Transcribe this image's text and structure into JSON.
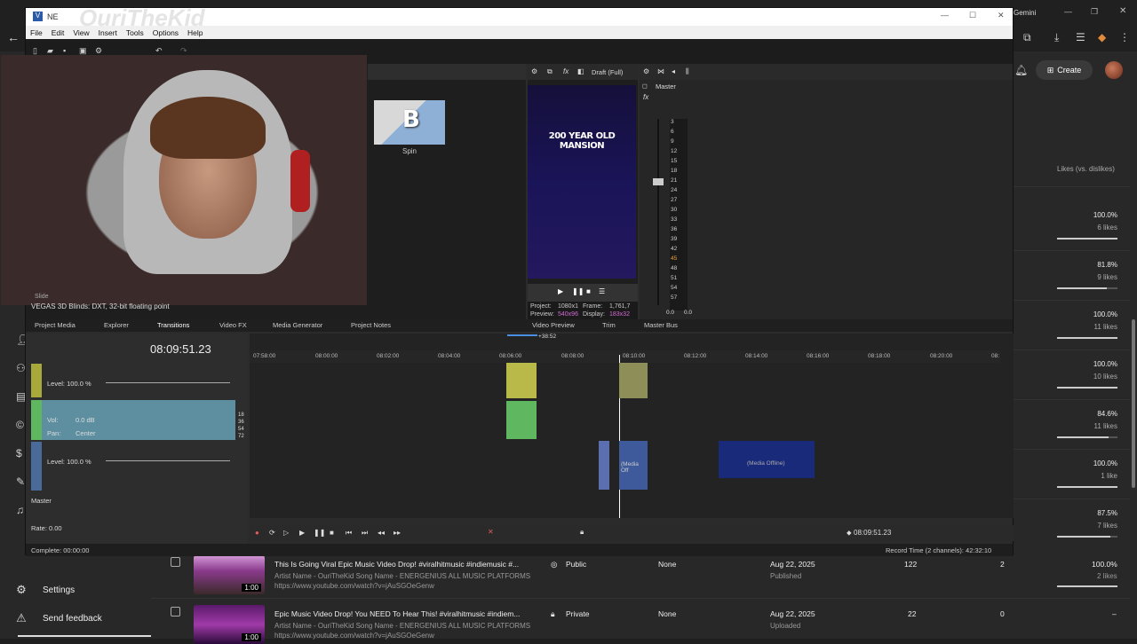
{
  "studio": {
    "create_label": "Create",
    "gemini_label": "Gemini",
    "likes_header": "Likes (vs. dislikes)",
    "likes": [
      {
        "pct": "100.0%",
        "count": "6 likes",
        "fill": 1.0
      },
      {
        "pct": "81.8%",
        "count": "9 likes",
        "fill": 0.818
      },
      {
        "pct": "100.0%",
        "count": "11 likes",
        "fill": 1.0
      },
      {
        "pct": "100.0%",
        "count": "10 likes",
        "fill": 1.0
      },
      {
        "pct": "84.6%",
        "count": "11 likes",
        "fill": 0.846
      },
      {
        "pct": "100.0%",
        "count": "1 like",
        "fill": 1.0
      },
      {
        "pct": "87.5%",
        "count": "7 likes",
        "fill": 0.875
      }
    ],
    "sidebar": {
      "settings": "Settings",
      "send_feedback": "Send feedback"
    },
    "videos": [
      {
        "title": "This Is Going Viral Epic Music Video Drop! #viralhitmusic #indiemusic #...",
        "desc1": "Artist Name - OuriTheKid Song Name - ENERGENIUS ALL MUSIC PLATFORMS",
        "desc2": "https://www.youtube.com/watch?v=jAuSGOeGenw",
        "duration": "1:00",
        "visibility": "Public",
        "restrictions": "None",
        "date": "Aug 22, 2025",
        "date_status": "Published",
        "views": "122",
        "comments": "2",
        "likes_pct": "100.0%",
        "likes_count": "2 likes"
      },
      {
        "title": "Epic Music Video Drop! You NEED To Hear This! #viralhitmusic #indiem...",
        "desc1": "Artist Name - OuriTheKid Song Name - ENERGENIUS ALL MUSIC PLATFORMS",
        "desc2": "https://www.youtube.com/watch?v=jAuSGOeGenw",
        "duration": "1:00",
        "visibility": "Private",
        "restrictions": "None",
        "date": "Aug 22, 2025",
        "date_status": "Uploaded",
        "views": "22",
        "comments": "0",
        "likes_pct": "–"
      }
    ]
  },
  "overlay": {
    "watermark": "OuriTheKid"
  },
  "vegas": {
    "title": "NE",
    "menu": [
      "File",
      "Edit",
      "View",
      "Insert",
      "Tools",
      "Options",
      "Help"
    ],
    "spin_letter": "B",
    "spin_label": "Spin",
    "fx_slide": "Slide",
    "fx_name": "VEGAS 3D Blinds: DXT, 32-bit floating point",
    "preview_mode": "Draft (Full)",
    "preview_title": "200 YEAR OLD MANSION",
    "preview_info": {
      "project": "Project:",
      "project_val": "1080x1",
      "frame": "Frame:",
      "frame_val": "1,761,7",
      "preview": "Preview:",
      "preview_val": "540x96",
      "display": "Display:",
      "display_val": "183x32"
    },
    "master_label": "Master",
    "meter_ticks": [
      "3",
      "6",
      "9",
      "12",
      "15",
      "18",
      "21",
      "24",
      "27",
      "30",
      "33",
      "36",
      "39",
      "42",
      "45",
      "48",
      "51",
      "54",
      "57"
    ],
    "meter_vals": [
      "0.0",
      "0.0"
    ],
    "tabs": [
      "Project Media",
      "Explorer",
      "Transitions",
      "Video FX",
      "Media Generator",
      "Project Notes",
      "Video Preview",
      "Trim",
      "Master Bus"
    ],
    "cursor_time": "08:09:51.23",
    "ruler": [
      "07:58:00",
      "08:00:00",
      "08:02:00",
      "08:04:00",
      "08:06:00",
      "08:08:00",
      "08:10:00",
      "08:12:00",
      "08:14:00",
      "08:16:00",
      "08:18:00",
      "08:20:00",
      "08:"
    ],
    "marker_time": "+38:52",
    "tracks": {
      "t1_level": "Level: 100.0 %",
      "t2_vol": "Vol:",
      "t2_vol_val": "0.0 dB",
      "t2_pan": "Pan:",
      "t2_pan_val": "Center",
      "t3_level": "Level: 100.0 %",
      "master": "Master",
      "rate": "Rate: 0.00"
    },
    "db_scale": [
      "18",
      "36",
      "54",
      "72"
    ],
    "clip_label_a": "(Media Off",
    "clip_label_b": "(Media Offline)",
    "transport_time": "08:09:51.23",
    "status_left": "Complete: 00:00:00",
    "status_right": "Record Time (2 channels): 42:32:10"
  }
}
